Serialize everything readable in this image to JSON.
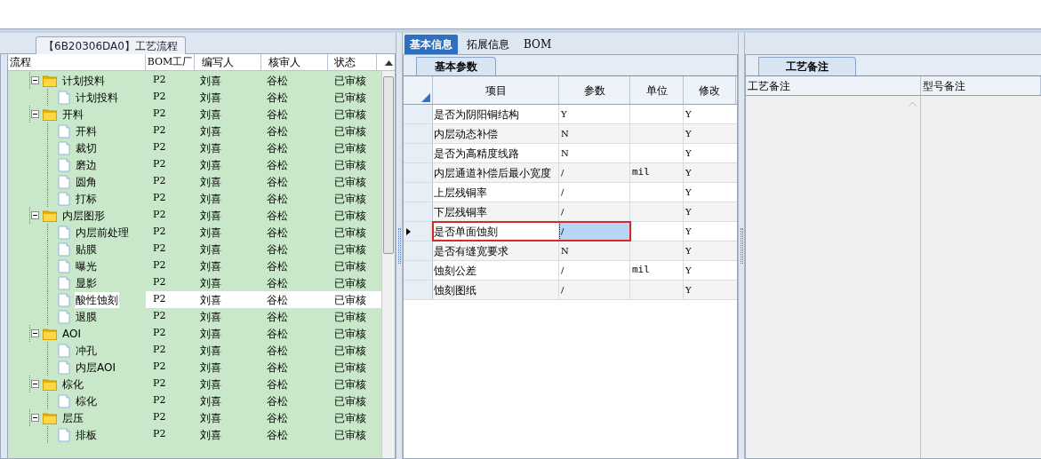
{
  "flow_panel": {
    "title": "【6B20306DA0】工艺流程",
    "columns": [
      "流程",
      "BOM工厂",
      "编写人",
      "核审人",
      "状态"
    ],
    "rows": [
      {
        "label": "计划投料",
        "kind": "folder",
        "expanded": true,
        "selected": false,
        "bom": "P2",
        "writer": "刘喜",
        "reviewer": "谷松",
        "status": "已审核",
        "children": [
          {
            "label": "计划投料",
            "kind": "file",
            "selected": false,
            "bom": "P2",
            "writer": "刘喜",
            "reviewer": "谷松",
            "status": "已审核"
          }
        ]
      },
      {
        "label": "开料",
        "kind": "folder",
        "expanded": true,
        "selected": false,
        "bom": "P2",
        "writer": "刘喜",
        "reviewer": "谷松",
        "status": "已审核",
        "children": [
          {
            "label": "开料",
            "kind": "file",
            "selected": false,
            "bom": "P2",
            "writer": "刘喜",
            "reviewer": "谷松",
            "status": "已审核"
          },
          {
            "label": "裁切",
            "kind": "file",
            "selected": false,
            "bom": "P2",
            "writer": "刘喜",
            "reviewer": "谷松",
            "status": "已审核"
          },
          {
            "label": "磨边",
            "kind": "file",
            "selected": false,
            "bom": "P2",
            "writer": "刘喜",
            "reviewer": "谷松",
            "status": "已审核"
          },
          {
            "label": "圆角",
            "kind": "file",
            "selected": false,
            "bom": "P2",
            "writer": "刘喜",
            "reviewer": "谷松",
            "status": "已审核"
          },
          {
            "label": "打标",
            "kind": "file",
            "selected": false,
            "bom": "P2",
            "writer": "刘喜",
            "reviewer": "谷松",
            "status": "已审核"
          }
        ]
      },
      {
        "label": "内层图形",
        "kind": "folder",
        "expanded": true,
        "selected": false,
        "bom": "P2",
        "writer": "刘喜",
        "reviewer": "谷松",
        "status": "已审核",
        "children": [
          {
            "label": "内层前处理",
            "kind": "file",
            "selected": false,
            "bom": "P2",
            "writer": "刘喜",
            "reviewer": "谷松",
            "status": "已审核"
          },
          {
            "label": "贴膜",
            "kind": "file",
            "selected": false,
            "bom": "P2",
            "writer": "刘喜",
            "reviewer": "谷松",
            "status": "已审核"
          },
          {
            "label": "曝光",
            "kind": "file",
            "selected": false,
            "bom": "P2",
            "writer": "刘喜",
            "reviewer": "谷松",
            "status": "已审核"
          },
          {
            "label": "显影",
            "kind": "file",
            "selected": false,
            "bom": "P2",
            "writer": "刘喜",
            "reviewer": "谷松",
            "status": "已审核"
          },
          {
            "label": "酸性蚀刻",
            "kind": "file",
            "selected": true,
            "bom": "P2",
            "writer": "刘喜",
            "reviewer": "谷松",
            "status": "已审核"
          },
          {
            "label": "退膜",
            "kind": "file",
            "selected": false,
            "bom": "P2",
            "writer": "刘喜",
            "reviewer": "谷松",
            "status": "已审核"
          }
        ]
      },
      {
        "label": "AOI",
        "kind": "folder",
        "expanded": true,
        "selected": false,
        "bom": "P2",
        "writer": "刘喜",
        "reviewer": "谷松",
        "status": "已审核",
        "children": [
          {
            "label": "冲孔",
            "kind": "file",
            "selected": false,
            "bom": "P2",
            "writer": "刘喜",
            "reviewer": "谷松",
            "status": "已审核"
          },
          {
            "label": "内层AOI",
            "kind": "file",
            "selected": false,
            "bom": "P2",
            "writer": "刘喜",
            "reviewer": "谷松",
            "status": "已审核"
          }
        ]
      },
      {
        "label": "棕化",
        "kind": "folder",
        "expanded": true,
        "selected": false,
        "bom": "P2",
        "writer": "刘喜",
        "reviewer": "谷松",
        "status": "已审核",
        "children": [
          {
            "label": "棕化",
            "kind": "file",
            "selected": false,
            "bom": "P2",
            "writer": "刘喜",
            "reviewer": "谷松",
            "status": "已审核"
          }
        ]
      },
      {
        "label": "层压",
        "kind": "folder",
        "expanded": true,
        "selected": false,
        "bom": "P2",
        "writer": "刘喜",
        "reviewer": "谷松",
        "status": "已审核",
        "children": [
          {
            "label": "排板",
            "kind": "file",
            "selected": false,
            "bom": "P2",
            "writer": "刘喜",
            "reviewer": "谷松",
            "status": "已审核"
          }
        ]
      }
    ]
  },
  "detail_tabs": [
    {
      "label": "基本信息",
      "selected": true
    },
    {
      "label": "拓展信息",
      "selected": false
    },
    {
      "label": "BOM",
      "selected": false
    }
  ],
  "params_panel": {
    "tab": "基本参数",
    "columns": [
      "项目",
      "参数",
      "单位",
      "修改"
    ],
    "rows": [
      {
        "item": "是否为阴阳铜结构",
        "param": "Y",
        "modify": "Y",
        "selected": false
      },
      {
        "item": "内层动态补偿",
        "param": "N",
        "modify": "Y",
        "selected": false
      },
      {
        "item": "是否为高精度线路",
        "param": "N",
        "modify": "Y",
        "selected": false
      },
      {
        "item": "内层通道补偿后最小宽度",
        "param": "/",
        "unit": "mil",
        "modify": "Y",
        "selected": false
      },
      {
        "item": "上层残铜率",
        "param": "/",
        "modify": "Y",
        "selected": false
      },
      {
        "item": "下层残铜率",
        "param": "/",
        "modify": "Y",
        "selected": false
      },
      {
        "item": "是否单面蚀刻",
        "param": "/",
        "modify": "Y",
        "selected": true
      },
      {
        "item": "是否有缝宽要求",
        "param": "N",
        "modify": "Y",
        "selected": false
      },
      {
        "item": "蚀刻公差",
        "param": "/",
        "unit": "mil",
        "modify": "Y",
        "selected": false
      },
      {
        "item": "蚀刻图纸",
        "param": "/",
        "modify": "Y",
        "selected": false
      }
    ]
  },
  "notes_panel": {
    "tab": "工艺备注",
    "columns": [
      "工艺备注",
      "型号备注"
    ]
  }
}
